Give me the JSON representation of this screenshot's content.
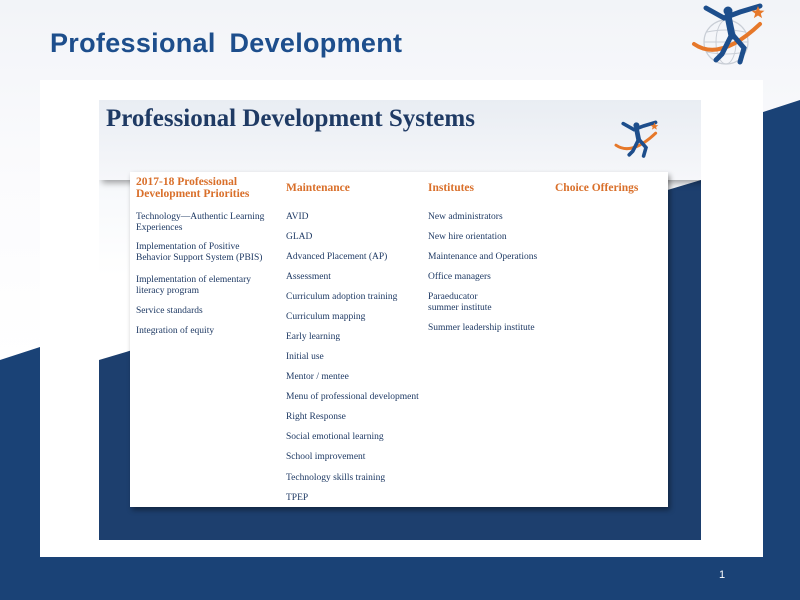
{
  "slide": {
    "title": "Professional  Development",
    "page_number": "1"
  },
  "embedded_slide": {
    "title": "Professional Development Systems",
    "columns": [
      {
        "heading_lines": [
          "2017-18 Professional",
          "Development Priorities"
        ],
        "items": [
          [
            "Technology—Authentic Learning",
            "Experiences"
          ],
          [
            "Implementation of Positive",
            "Behavior Support System (PBIS)"
          ],
          [
            "Implementation of elementary",
            "literacy program"
          ],
          [
            "Service standards"
          ],
          [
            "Integration of equity"
          ]
        ]
      },
      {
        "heading_lines": [
          "Maintenance"
        ],
        "items": [
          [
            "AVID"
          ],
          [
            "GLAD"
          ],
          [
            "Advanced Placement (AP)"
          ],
          [
            "Assessment"
          ],
          [
            "Curriculum adoption training"
          ],
          [
            "Curriculum  mapping"
          ],
          [
            "Early learning"
          ],
          [
            "Initial use"
          ],
          [
            "Mentor / mentee"
          ],
          [
            "Menu of professional development"
          ],
          [
            "Right Response"
          ],
          [
            "Social emotional learning"
          ],
          [
            "School improvement"
          ],
          [
            "Technology skills training"
          ],
          [
            "TPEP"
          ]
        ]
      },
      {
        "heading_lines": [
          "Institutes"
        ],
        "items": [
          [
            "New administrators"
          ],
          [
            "New hire orientation"
          ],
          [
            "Maintenance and Operations"
          ],
          [
            "Office managers"
          ],
          [
            "Paraeducator",
            "summer institute"
          ],
          [
            "Summer leadership institute"
          ]
        ]
      },
      {
        "heading_lines": [
          "Choice Offerings"
        ],
        "items": []
      }
    ]
  },
  "colors": {
    "title_blue": "#1d4e8c",
    "navy": "#1a4276",
    "heading_orange": "#d96f2a",
    "item_navy": "#1f3a64"
  },
  "icons": [
    "figure-with-star-logo-icon"
  ]
}
